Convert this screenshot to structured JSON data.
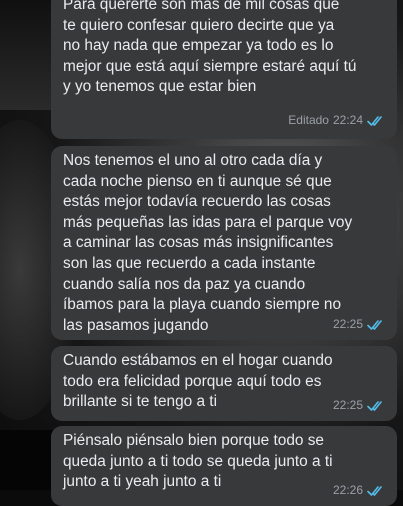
{
  "messages": [
    {
      "text": "Para quererte son más de mil cosas que\nte quiero confesar quiero decirte que ya\nno hay nada que empezar ya todo es lo\nmejor que está aquí siempre estaré aquí tú\ny yo tenemos que estar bien",
      "edited_label": "Editado",
      "time": "22:24",
      "status_icon": "double-check-read-icon"
    },
    {
      "text": "Nos tenemos el uno al otro cada día y\ncada noche pienso en ti aunque sé que\nestás mejor todavía recuerdo las cosas\nmás pequeñas las idas para el parque voy\na caminar las cosas más insignificantes\nson las que recuerdo a cada instante\ncuando salía nos da paz ya cuando\níbamos para la playa cuando siempre no\nlas pasamos jugando",
      "time": "22:25",
      "status_icon": "double-check-read-icon"
    },
    {
      "text": "Cuando estábamos en el hogar cuando\ntodo era felicidad porque aquí todo es\nbrillante si te tengo a ti",
      "time": "22:25",
      "status_icon": "double-check-read-icon"
    },
    {
      "text": "Piénsalo piénsalo bien porque todo se\nqueda junto a ti todo se queda junto a ti\njunto a ti yeah junto a ti",
      "time": "22:26",
      "status_icon": "double-check-read-icon"
    }
  ],
  "colors": {
    "bubble_bg": "#38393b",
    "text": "#e9ecee",
    "meta": "#9aa0a6",
    "read_check": "#53bdeb"
  }
}
